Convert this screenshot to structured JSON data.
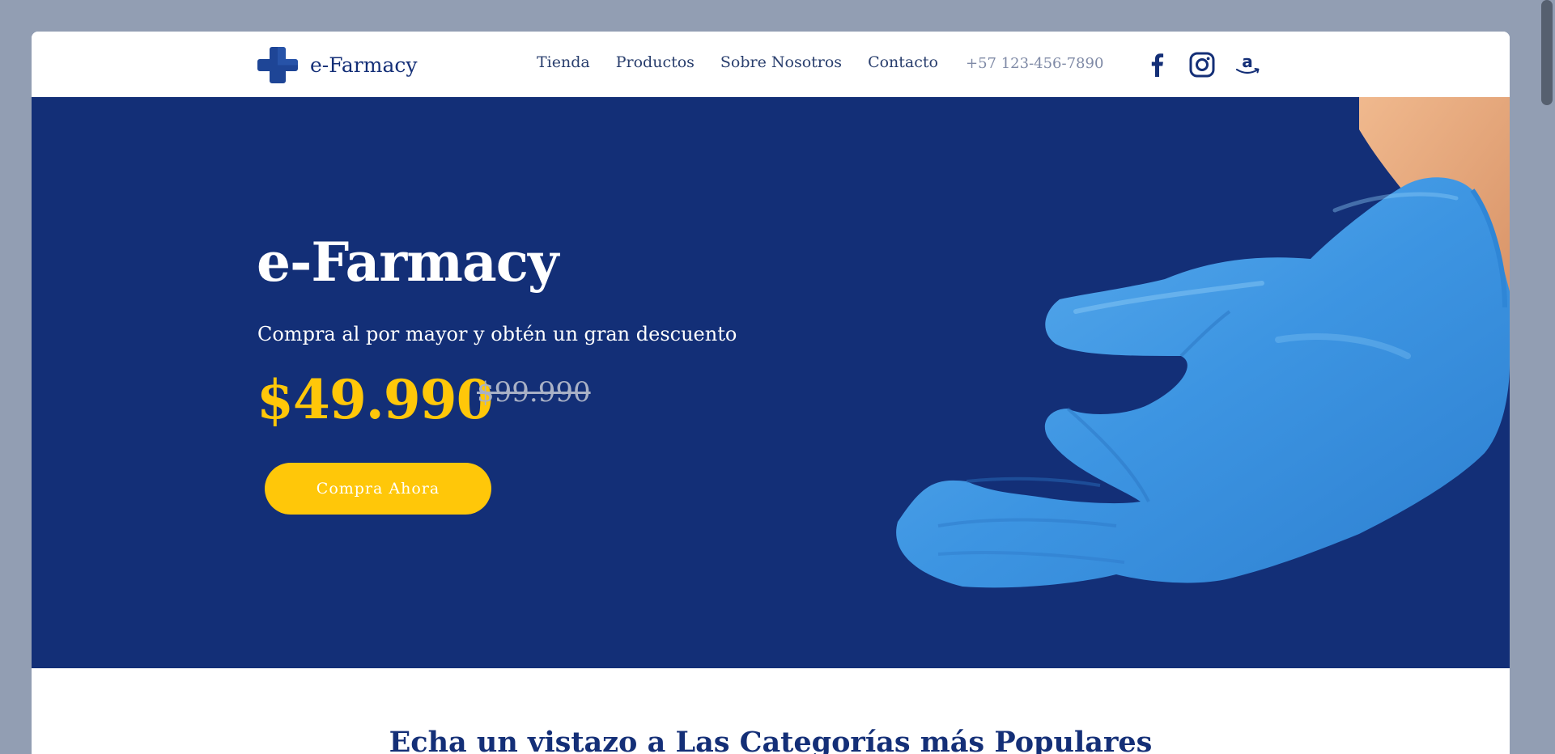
{
  "header": {
    "brand": "e-Farmacy",
    "nav": [
      "Tienda",
      "Productos",
      "Sobre Nosotros",
      "Contacto"
    ],
    "phone": "+57 123-456-7890",
    "social_icons": [
      "facebook-icon",
      "instagram-icon",
      "amazon-icon"
    ]
  },
  "hero": {
    "title": "e-Farmacy",
    "subtitle": "Compra al por mayor y obtén un gran descuento",
    "price_current": "$49.990",
    "price_old": "$99.990",
    "cta_label": "Compra Ahora"
  },
  "categories": {
    "title": "Echa un vistazo a Las Categorías más Populares"
  },
  "colors": {
    "brand_navy": "#132f77",
    "accent_yellow": "#ffc709",
    "glove_blue": "#3d95e2",
    "page_bg": "#929eb3"
  }
}
